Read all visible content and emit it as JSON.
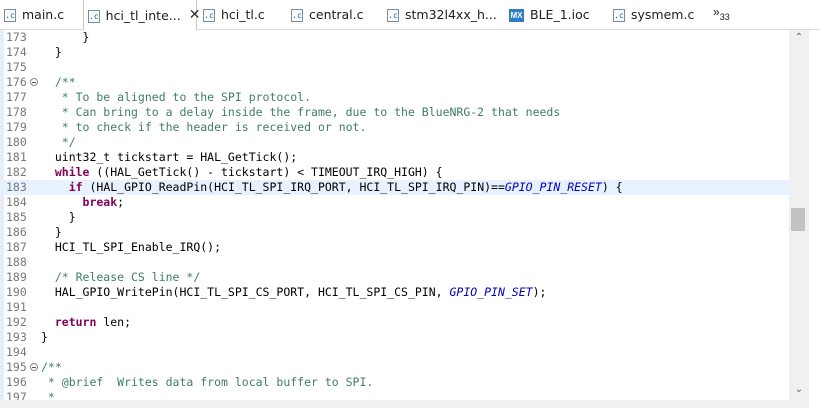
{
  "tabs": [
    {
      "label": "main.c",
      "icon": "c-file-icon",
      "icon_text": ".c",
      "active": false
    },
    {
      "label": "hci_tl_inte...",
      "icon": "c-file-icon",
      "icon_text": ".c",
      "active": true
    },
    {
      "label": "hci_tl.c",
      "icon": "c-file-icon",
      "icon_text": ".c",
      "active": false
    },
    {
      "label": "central.c",
      "icon": "c-file-icon",
      "icon_text": ".c",
      "active": false
    },
    {
      "label": "stm32l4xx_h...",
      "icon": "c-file-icon",
      "icon_text": ".c",
      "active": false
    },
    {
      "label": "BLE_1.ioc",
      "icon": "mx-file-icon",
      "icon_text": "MX",
      "active": false
    },
    {
      "label": "sysmem.c",
      "icon": "c-file-icon",
      "icon_text": ".c",
      "active": false
    }
  ],
  "close_glyph": "✕",
  "overflow": {
    "glyph": "»",
    "count": "33"
  },
  "scroll_up_glyph": "⌃",
  "scroll_down_glyph": "⌄",
  "highlight_color": "#e8f2fe",
  "lines": [
    {
      "n": "173",
      "fold": false,
      "hl": false,
      "parts": [
        {
          "t": "n",
          "s": "      }"
        }
      ]
    },
    {
      "n": "174",
      "fold": false,
      "hl": false,
      "parts": [
        {
          "t": "n",
          "s": "  }"
        }
      ]
    },
    {
      "n": "175",
      "fold": false,
      "hl": false,
      "parts": []
    },
    {
      "n": "176",
      "fold": true,
      "hl": false,
      "parts": [
        {
          "t": "c",
          "s": "  /**"
        }
      ]
    },
    {
      "n": "177",
      "fold": false,
      "hl": false,
      "parts": [
        {
          "t": "c",
          "s": "   * To be aligned to the SPI protocol."
        }
      ]
    },
    {
      "n": "178",
      "fold": false,
      "hl": false,
      "parts": [
        {
          "t": "c",
          "s": "   * Can bring to a delay inside the frame, due to the BlueNRG-2 that needs"
        }
      ]
    },
    {
      "n": "179",
      "fold": false,
      "hl": false,
      "parts": [
        {
          "t": "c",
          "s": "   * to check if the header is received or not."
        }
      ]
    },
    {
      "n": "180",
      "fold": false,
      "hl": false,
      "parts": [
        {
          "t": "c",
          "s": "   */"
        }
      ]
    },
    {
      "n": "181",
      "fold": false,
      "hl": false,
      "parts": [
        {
          "t": "n",
          "s": "  uint32_t tickstart = HAL_GetTick();"
        }
      ]
    },
    {
      "n": "182",
      "fold": false,
      "hl": false,
      "parts": [
        {
          "t": "k",
          "s": "  while"
        },
        {
          "t": "n",
          "s": " ((HAL_GetTick() - tickstart) < TIMEOUT_IRQ_HIGH) {"
        }
      ]
    },
    {
      "n": "183",
      "fold": false,
      "hl": true,
      "parts": [
        {
          "t": "k",
          "s": "    if"
        },
        {
          "t": "n",
          "s": " (HAL_GPIO_ReadPin(HCI_TL_SPI_IRQ_PORT, HCI_TL_SPI_IRQ_PIN)=="
        },
        {
          "t": "m",
          "s": "GPIO_PIN_RESET"
        },
        {
          "t": "n",
          "s": ") {"
        }
      ]
    },
    {
      "n": "184",
      "fold": false,
      "hl": false,
      "parts": [
        {
          "t": "k",
          "s": "      break"
        },
        {
          "t": "n",
          "s": ";"
        }
      ]
    },
    {
      "n": "185",
      "fold": false,
      "hl": false,
      "parts": [
        {
          "t": "n",
          "s": "    }"
        }
      ]
    },
    {
      "n": "186",
      "fold": false,
      "hl": false,
      "parts": [
        {
          "t": "n",
          "s": "  }"
        }
      ]
    },
    {
      "n": "187",
      "fold": false,
      "hl": false,
      "parts": [
        {
          "t": "n",
          "s": "  HCI_TL_SPI_Enable_IRQ();"
        }
      ]
    },
    {
      "n": "188",
      "fold": false,
      "hl": false,
      "parts": []
    },
    {
      "n": "189",
      "fold": false,
      "hl": false,
      "parts": [
        {
          "t": "c",
          "s": "  /* Release CS line */"
        }
      ]
    },
    {
      "n": "190",
      "fold": false,
      "hl": false,
      "parts": [
        {
          "t": "n",
          "s": "  HAL_GPIO_WritePin(HCI_TL_SPI_CS_PORT, HCI_TL_SPI_CS_PIN, "
        },
        {
          "t": "m",
          "s": "GPIO_PIN_SET"
        },
        {
          "t": "n",
          "s": ");"
        }
      ]
    },
    {
      "n": "191",
      "fold": false,
      "hl": false,
      "parts": []
    },
    {
      "n": "192",
      "fold": false,
      "hl": false,
      "parts": [
        {
          "t": "k",
          "s": "  return"
        },
        {
          "t": "n",
          "s": " len;"
        }
      ]
    },
    {
      "n": "193",
      "fold": false,
      "hl": false,
      "parts": [
        {
          "t": "n",
          "s": "}"
        }
      ]
    },
    {
      "n": "194",
      "fold": false,
      "hl": false,
      "parts": []
    },
    {
      "n": "195",
      "fold": true,
      "hl": false,
      "parts": [
        {
          "t": "c",
          "s": "/**"
        }
      ]
    },
    {
      "n": "196",
      "fold": false,
      "hl": false,
      "parts": [
        {
          "t": "c",
          "s": " * @brief  Writes data from local buffer to SPI."
        }
      ]
    },
    {
      "n": "197",
      "fold": false,
      "hl": false,
      "parts": [
        {
          "t": "c",
          "s": " *"
        }
      ]
    }
  ]
}
